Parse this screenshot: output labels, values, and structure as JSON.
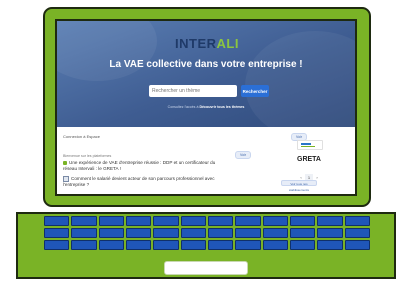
{
  "hero": {
    "logo_main": "INTER",
    "logo_accent": "ALI",
    "title": "La VAE collective dans votre entreprise !",
    "search_placeholder": "Rechercher un thème",
    "search_button": "Rechercher",
    "subtitle_prefix": "Consultez l'accès à ",
    "subtitle_link": "Découvrir tous les thèmes"
  },
  "content": {
    "topic_line": "Connexion à Espace",
    "pill_top": "Voir",
    "pill_mid": "Voir",
    "label_small": "Bienvenue sur les plateformes",
    "item1": "Une expérience de VAE d'entreprise réussie : DDP et un certificateur du réseau Intervali : le GRETA !",
    "item2": "Comment le salarié devient acteur de son parcours professionnel avec l'entreprise ?",
    "greta": "GRETA",
    "stepper_minus": "‹",
    "stepper_value": "1",
    "stepper_plus": "›",
    "partners_button": "Voir tous nos établissements"
  },
  "colors": {
    "laptop_green": "#7ab326",
    "key_blue": "#1f56b8",
    "hero_blue": "#3f5d92",
    "button_blue": "#2b6fd6"
  },
  "icons": {
    "check": "check-square-icon",
    "doc": "document-icon",
    "greta_logo": "greta-logo-icon"
  }
}
